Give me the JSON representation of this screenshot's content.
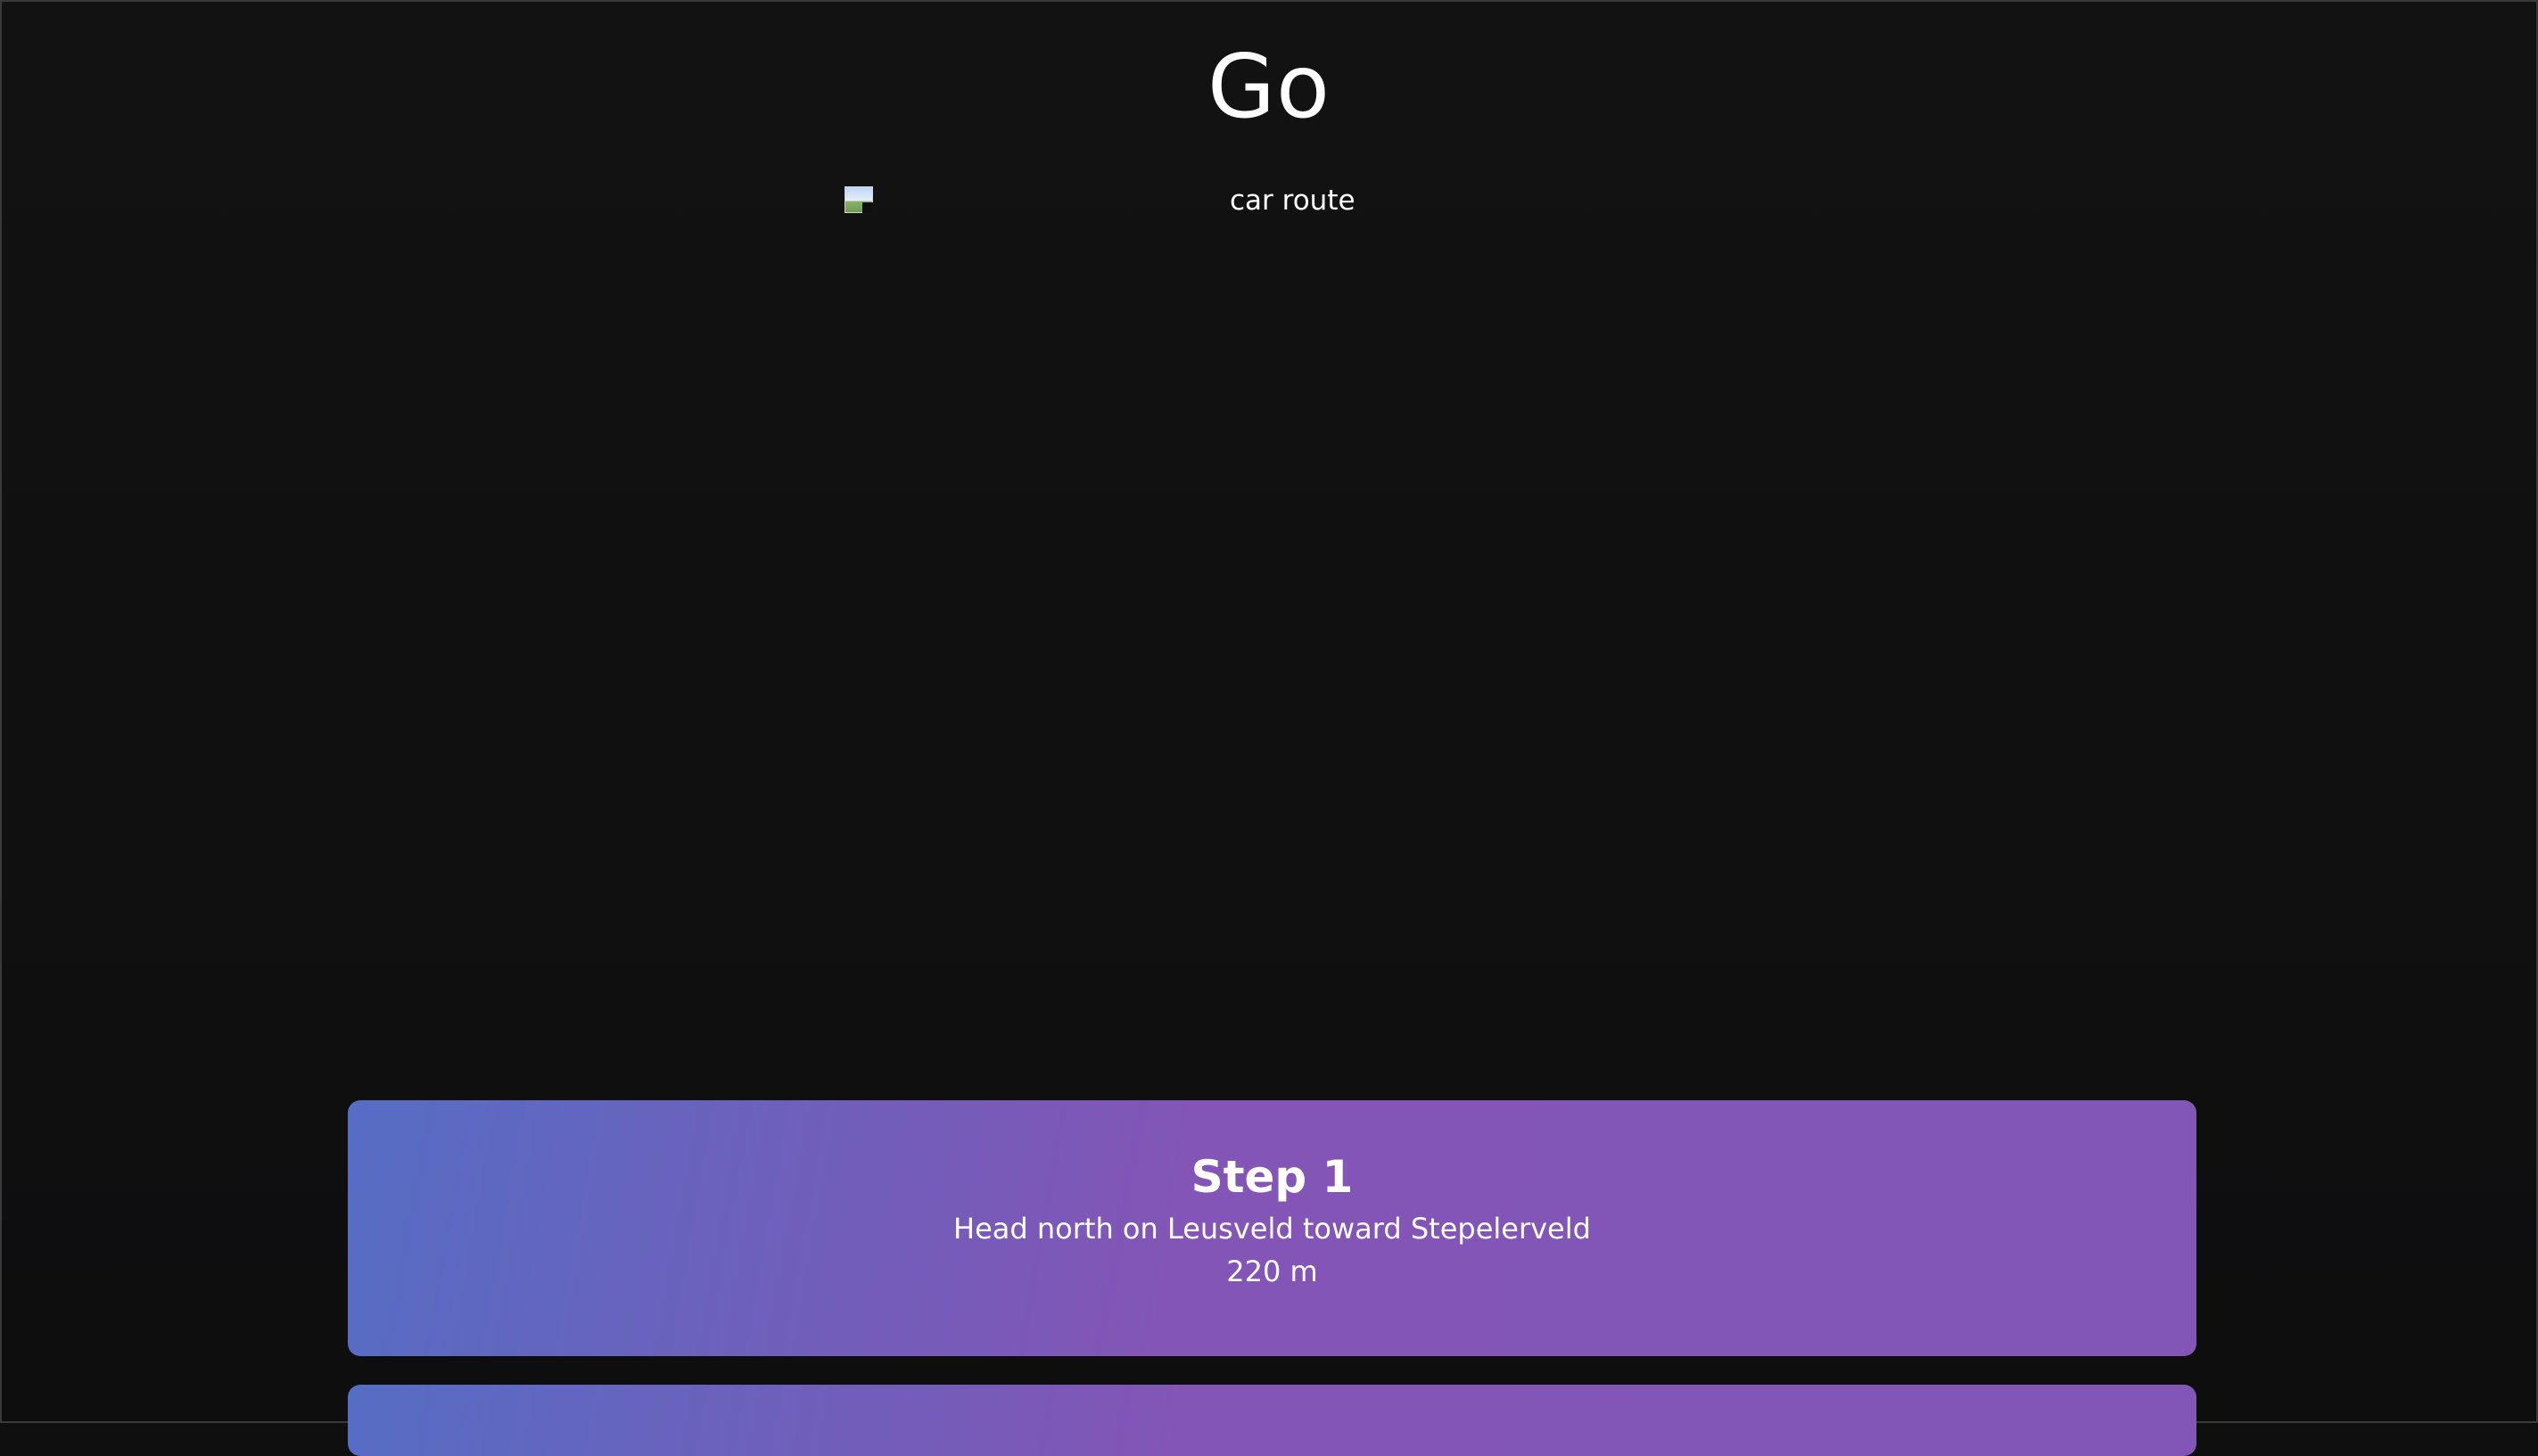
{
  "header": {
    "title": "Go"
  },
  "route_image": {
    "alt": "car route",
    "icon": "broken-image-icon"
  },
  "steps": [
    {
      "title": "Step 1",
      "instruction": "Head north on Leusveld toward Stepelerveld",
      "distance": "220 m"
    }
  ],
  "colors": {
    "background": "#0f0f10",
    "card_gradient_start": "#566dc4",
    "card_gradient_end": "#8256b6",
    "text": "#ffffff"
  }
}
